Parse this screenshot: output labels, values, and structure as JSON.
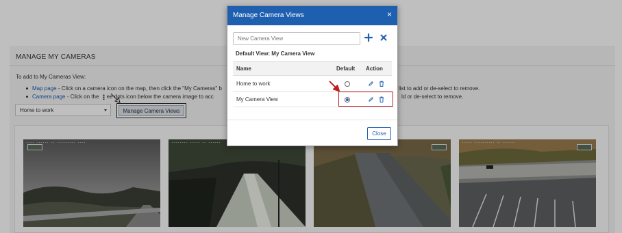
{
  "page": {
    "title": "MANAGE MY CAMERAS",
    "intro": "To add to My Cameras View:",
    "bullets": [
      {
        "link": "Map page",
        "text": " - Click on a camera icon on the map, then click the \"My Cameras\" b",
        "tail": "list to add or de-select to remove."
      },
      {
        "link": "Camera page",
        "text_before": " - Click on the ",
        "text_after": "ee dots icon below the camera image to acc",
        "tail": "ld or de-select to remove."
      }
    ],
    "view_select": {
      "value": "Home to work"
    },
    "manage_button_label": "Manage Camera Views"
  },
  "cameras": [
    {
      "timestamp": "---- ------ -- --------- ----"
    },
    {
      "timestamp": "-------- ----- -- ------"
    },
    {
      "timestamp": "--------- ---- -- ------"
    },
    {
      "timestamp": "----- ---------- -- ------"
    }
  ],
  "modal": {
    "title": "Manage Camera Views",
    "close_symbol": "×",
    "new_view_placeholder": "New Camera View",
    "default_view_label": "Default View: My Camera View",
    "columns": [
      "Name",
      "Default",
      "Action"
    ],
    "rows": [
      {
        "name": "Home to work",
        "default": false
      },
      {
        "name": "My Camera View",
        "default": true
      }
    ],
    "close_button_label": "Close"
  },
  "colors": {
    "header_blue": "#1f5fb0",
    "highlight_red": "#c01e22",
    "link_blue": "#1a5db4"
  },
  "icons": [
    "plus-icon",
    "x-icon",
    "edit-icon",
    "trash-icon",
    "close-icon",
    "kebab-icon",
    "caret-down-icon"
  ]
}
